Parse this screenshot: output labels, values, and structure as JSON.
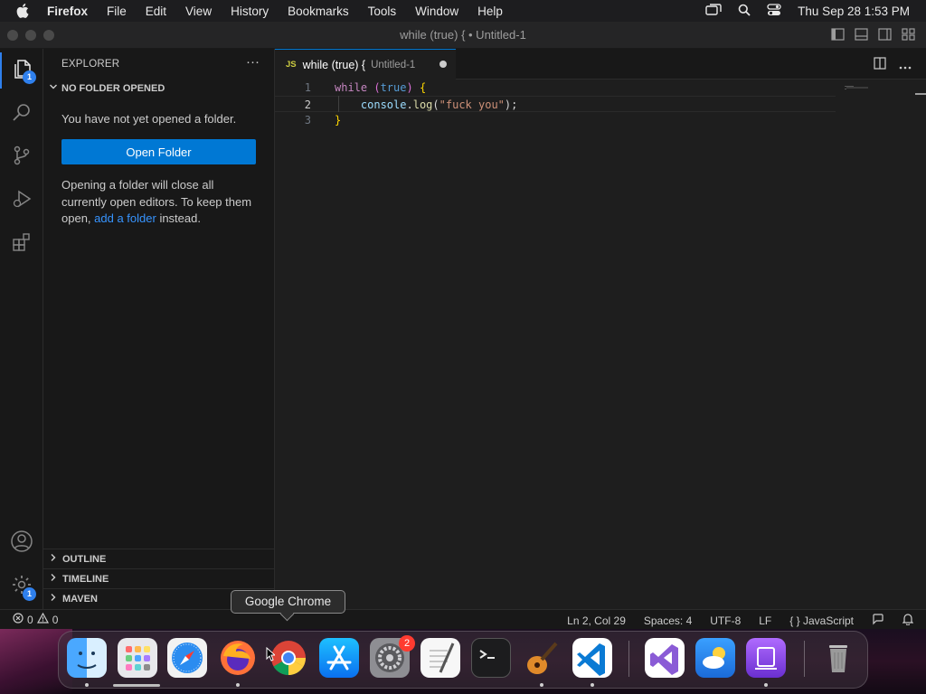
{
  "menubar": {
    "app_name": "Firefox",
    "items": [
      "File",
      "Edit",
      "View",
      "History",
      "Bookmarks",
      "Tools",
      "Window",
      "Help"
    ],
    "clock": "Thu Sep 28  1:53 PM"
  },
  "window": {
    "title": "while (true) { • Untitled-1"
  },
  "activity_bar": {
    "explorer_badge": "1",
    "manage_badge": "1"
  },
  "sidebar": {
    "header": "EXPLORER",
    "more": "···",
    "section": "NO FOLDER OPENED",
    "message": "You have not yet opened a folder.",
    "open_folder_label": "Open Folder",
    "note_prefix": "Opening a folder will close all currently open editors. To keep them open, ",
    "note_link": "add a folder",
    "note_suffix": " instead.",
    "outline": "OUTLINE",
    "timeline": "TIMELINE",
    "maven": "MAVEN"
  },
  "tab": {
    "lang_badge": "JS",
    "name": "while (true) {",
    "description": "Untitled-1"
  },
  "editor": {
    "line_numbers": [
      "1",
      "2",
      "3"
    ],
    "line1": {
      "kw": "while",
      "open_paren": " (",
      "bool": "true",
      "close_paren": ")",
      "brace": " {"
    },
    "line2": {
      "indent": "    ",
      "ident": "console",
      "dot": ".",
      "fn": "log",
      "open": "(",
      "str": "\"fuck you\"",
      "close": ");"
    },
    "line3": {
      "brace": "}"
    }
  },
  "statusbar": {
    "errors": "0",
    "warnings": "0",
    "position": "Ln 2, Col 29",
    "spaces": "Spaces: 4",
    "encoding": "UTF-8",
    "eol": "LF",
    "language_braces": "{ }",
    "language": "JavaScript"
  },
  "dock": {
    "tooltip": "Google Chrome",
    "settings_badge": "2"
  },
  "colors": {
    "accent": "#0078d4",
    "link": "#3794ff",
    "badge": "#2f80ed"
  }
}
